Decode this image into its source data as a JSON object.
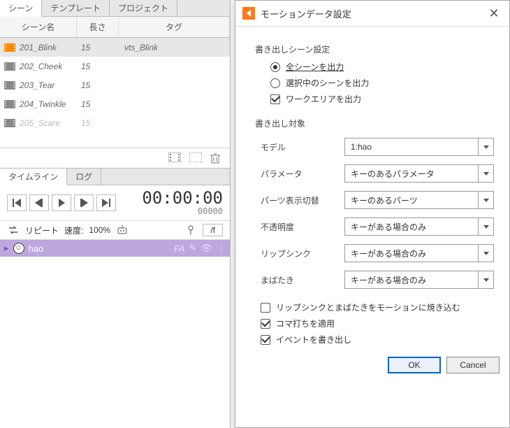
{
  "left": {
    "tabs": [
      "シーン",
      "テンプレート",
      "プロジェクト"
    ],
    "columns": {
      "name": "シーン名",
      "length": "長さ",
      "tag": "タグ"
    },
    "scenes": [
      {
        "name": "201_Blink",
        "length": "15",
        "tag": "vts_Blink",
        "selected": true
      },
      {
        "name": "202_Cheek",
        "length": "15",
        "tag": "",
        "selected": false
      },
      {
        "name": "203_Tear",
        "length": "15",
        "tag": "",
        "selected": false
      },
      {
        "name": "204_Twinkle",
        "length": "15",
        "tag": "",
        "selected": false
      },
      {
        "name": "205_Scare",
        "length": "15",
        "tag": "",
        "selected": false
      }
    ],
    "subtabs": [
      "タイムライン",
      "ログ"
    ],
    "timecode": "00:00:00",
    "timecode_sub": "00000",
    "repeat_label": "リピート",
    "speed_label": "速度:",
    "speed_value": "100%",
    "frame_field": "/f",
    "track": {
      "name": "hao",
      "tag": "FA"
    }
  },
  "dialog": {
    "title": "モーションデータ設定",
    "section_export": "書き出しシーン設定",
    "radio_all": "全シーンを出力",
    "radio_selected": "選択中のシーンを出力",
    "check_workarea": "ワークエリアを出力",
    "section_target": "書き出し対象",
    "fields": [
      {
        "label": "モデル",
        "value": "1:hao"
      },
      {
        "label": "パラメータ",
        "value": "キーのあるパラメータ"
      },
      {
        "label": "パーツ表示切替",
        "value": "キーのあるパーツ"
      },
      {
        "label": "不透明度",
        "value": "キーがある場合のみ"
      },
      {
        "label": "リップシンク",
        "value": "キーがある場合のみ"
      },
      {
        "label": "まばたき",
        "value": "キーがある場合のみ"
      }
    ],
    "check_bake": "リップシンクとまばたきをモーションに焼き込む",
    "check_koma": "コマ打ちを適用",
    "check_event": "イベントを書き出し",
    "btn_ok": "OK",
    "btn_cancel": "Cancel"
  }
}
